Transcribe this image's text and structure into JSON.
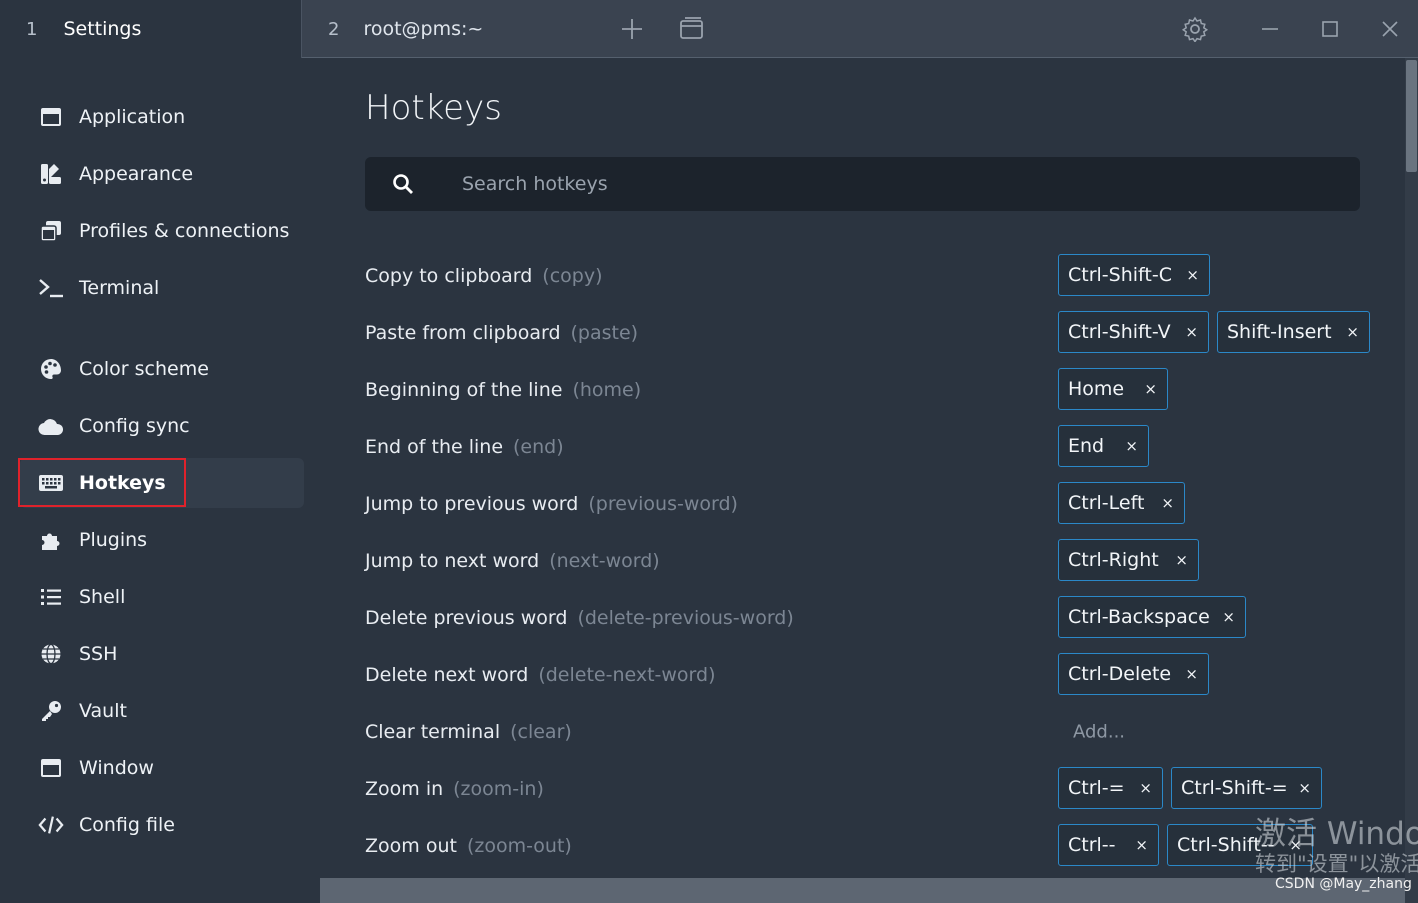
{
  "tabs": [
    {
      "index": "1",
      "title": "Settings"
    },
    {
      "index": "2",
      "title": "root@pms:~"
    }
  ],
  "sidebar": {
    "items": [
      {
        "label": "Application",
        "icon": "window-icon"
      },
      {
        "label": "Appearance",
        "icon": "appearance-icon"
      },
      {
        "label": "Profiles & connections",
        "icon": "profiles-icon"
      },
      {
        "label": "Terminal",
        "icon": "terminal-icon"
      },
      {
        "label": "Color scheme",
        "icon": "palette-icon"
      },
      {
        "label": "Config sync",
        "icon": "cloud-icon"
      },
      {
        "label": "Hotkeys",
        "icon": "keyboard-icon",
        "active": true
      },
      {
        "label": "Plugins",
        "icon": "puzzle-icon"
      },
      {
        "label": "Shell",
        "icon": "list-icon"
      },
      {
        "label": "SSH",
        "icon": "globe-icon"
      },
      {
        "label": "Vault",
        "icon": "key-icon"
      },
      {
        "label": "Window",
        "icon": "window-icon"
      },
      {
        "label": "Config file",
        "icon": "code-icon"
      }
    ]
  },
  "main": {
    "title": "Hotkeys",
    "search_placeholder": "Search hotkeys",
    "add_label": "Add...",
    "hotkeys": [
      {
        "name": "Copy to clipboard",
        "id": "(copy)",
        "keys": [
          "Ctrl-Shift-C"
        ]
      },
      {
        "name": "Paste from clipboard",
        "id": "(paste)",
        "keys": [
          "Ctrl-Shift-V",
          "Shift-Insert"
        ]
      },
      {
        "name": "Beginning of the line",
        "id": "(home)",
        "keys": [
          "Home"
        ]
      },
      {
        "name": "End of the line",
        "id": "(end)",
        "keys": [
          "End"
        ]
      },
      {
        "name": "Jump to previous word",
        "id": "(previous-word)",
        "keys": [
          "Ctrl-Left"
        ]
      },
      {
        "name": "Jump to next word",
        "id": "(next-word)",
        "keys": [
          "Ctrl-Right"
        ]
      },
      {
        "name": "Delete previous word",
        "id": "(delete-previous-word)",
        "keys": [
          "Ctrl-Backspace"
        ]
      },
      {
        "name": "Delete next word",
        "id": "(delete-next-word)",
        "keys": [
          "Ctrl-Delete"
        ]
      },
      {
        "name": "Clear terminal",
        "id": "(clear)",
        "keys": []
      },
      {
        "name": "Zoom in",
        "id": "(zoom-in)",
        "keys": [
          "Ctrl-=",
          "Ctrl-Shift-="
        ]
      },
      {
        "name": "Zoom out",
        "id": "(zoom-out)",
        "keys": [
          "Ctrl--",
          "Ctrl-Shift--"
        ]
      }
    ]
  },
  "chip_close_glyph": "×",
  "watermark": {
    "line1": "激活 Windo",
    "line2": "转到\"设置\"以激活",
    "credit": "CSDN @May_zhang"
  },
  "colors": {
    "background": "#2b3440",
    "chip_border": "#2b88c8",
    "highlight_box": "#e0222b"
  }
}
